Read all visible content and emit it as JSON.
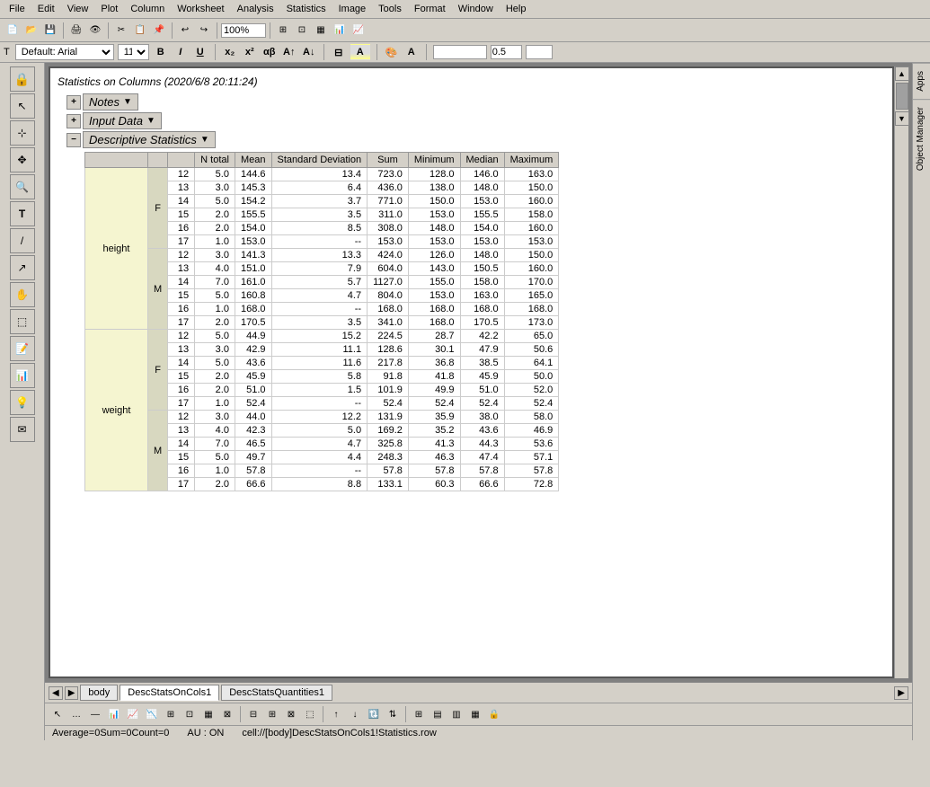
{
  "window": {
    "title": "Statistics on Columns (2020/6/8 20:11:24)"
  },
  "menu": {
    "items": [
      "File",
      "Edit",
      "View",
      "Plot",
      "Column",
      "Worksheet",
      "Analysis",
      "Statistics",
      "Image",
      "Tools",
      "Format",
      "Window",
      "Help"
    ]
  },
  "format_bar": {
    "font": "Default: Arial",
    "size": "11",
    "bold": "B",
    "italic": "I",
    "underline": "U",
    "zoom": "100%"
  },
  "tree": {
    "notes_label": "Notes",
    "input_label": "Input Data",
    "desc_label": "Descriptive Statistics"
  },
  "table": {
    "headers": [
      "",
      "",
      "",
      "N total",
      "Mean",
      "Standard Deviation",
      "Sum",
      "Minimum",
      "Median",
      "Maximum"
    ],
    "rows": [
      {
        "group1": "height",
        "group2": "F",
        "age": "12",
        "n": "5.0",
        "mean": "144.6",
        "sd": "13.4",
        "sum": "723.0",
        "min": "128.0",
        "median": "146.0",
        "max": "163.0"
      },
      {
        "group1": "",
        "group2": "",
        "age": "13",
        "n": "3.0",
        "mean": "145.3",
        "sd": "6.4",
        "sum": "436.0",
        "min": "138.0",
        "median": "148.0",
        "max": "150.0"
      },
      {
        "group1": "",
        "group2": "",
        "age": "14",
        "n": "5.0",
        "mean": "154.2",
        "sd": "3.7",
        "sum": "771.0",
        "min": "150.0",
        "median": "153.0",
        "max": "160.0"
      },
      {
        "group1": "",
        "group2": "",
        "age": "15",
        "n": "2.0",
        "mean": "155.5",
        "sd": "3.5",
        "sum": "311.0",
        "min": "153.0",
        "median": "155.5",
        "max": "158.0"
      },
      {
        "group1": "",
        "group2": "",
        "age": "16",
        "n": "2.0",
        "mean": "154.0",
        "sd": "8.5",
        "sum": "308.0",
        "min": "148.0",
        "median": "154.0",
        "max": "160.0"
      },
      {
        "group1": "",
        "group2": "",
        "age": "17",
        "n": "1.0",
        "mean": "153.0",
        "sd": "--",
        "sum": "153.0",
        "min": "153.0",
        "median": "153.0",
        "max": "153.0"
      },
      {
        "group1": "",
        "group2": "M",
        "age": "12",
        "n": "3.0",
        "mean": "141.3",
        "sd": "13.3",
        "sum": "424.0",
        "min": "126.0",
        "median": "148.0",
        "max": "150.0"
      },
      {
        "group1": "",
        "group2": "",
        "age": "13",
        "n": "4.0",
        "mean": "151.0",
        "sd": "7.9",
        "sum": "604.0",
        "min": "143.0",
        "median": "150.5",
        "max": "160.0"
      },
      {
        "group1": "",
        "group2": "",
        "age": "14",
        "n": "7.0",
        "mean": "161.0",
        "sd": "5.7",
        "sum": "1127.0",
        "min": "155.0",
        "median": "158.0",
        "max": "170.0"
      },
      {
        "group1": "",
        "group2": "",
        "age": "15",
        "n": "5.0",
        "mean": "160.8",
        "sd": "4.7",
        "sum": "804.0",
        "min": "153.0",
        "median": "163.0",
        "max": "165.0"
      },
      {
        "group1": "",
        "group2": "",
        "age": "16",
        "n": "1.0",
        "mean": "168.0",
        "sd": "--",
        "sum": "168.0",
        "min": "168.0",
        "median": "168.0",
        "max": "168.0"
      },
      {
        "group1": "",
        "group2": "",
        "age": "17",
        "n": "2.0",
        "mean": "170.5",
        "sd": "3.5",
        "sum": "341.0",
        "min": "168.0",
        "median": "170.5",
        "max": "173.0"
      },
      {
        "group1": "weight",
        "group2": "F",
        "age": "12",
        "n": "5.0",
        "mean": "44.9",
        "sd": "15.2",
        "sum": "224.5",
        "min": "28.7",
        "median": "42.2",
        "max": "65.0"
      },
      {
        "group1": "",
        "group2": "",
        "age": "13",
        "n": "3.0",
        "mean": "42.9",
        "sd": "11.1",
        "sum": "128.6",
        "min": "30.1",
        "median": "47.9",
        "max": "50.6"
      },
      {
        "group1": "",
        "group2": "",
        "age": "14",
        "n": "5.0",
        "mean": "43.6",
        "sd": "11.6",
        "sum": "217.8",
        "min": "36.8",
        "median": "38.5",
        "max": "64.1"
      },
      {
        "group1": "",
        "group2": "",
        "age": "15",
        "n": "2.0",
        "mean": "45.9",
        "sd": "5.8",
        "sum": "91.8",
        "min": "41.8",
        "median": "45.9",
        "max": "50.0"
      },
      {
        "group1": "",
        "group2": "",
        "age": "16",
        "n": "2.0",
        "mean": "51.0",
        "sd": "1.5",
        "sum": "101.9",
        "min": "49.9",
        "median": "51.0",
        "max": "52.0"
      },
      {
        "group1": "",
        "group2": "",
        "age": "17",
        "n": "1.0",
        "mean": "52.4",
        "sd": "--",
        "sum": "52.4",
        "min": "52.4",
        "median": "52.4",
        "max": "52.4"
      },
      {
        "group1": "",
        "group2": "M",
        "age": "12",
        "n": "3.0",
        "mean": "44.0",
        "sd": "12.2",
        "sum": "131.9",
        "min": "35.9",
        "median": "38.0",
        "max": "58.0"
      },
      {
        "group1": "",
        "group2": "",
        "age": "13",
        "n": "4.0",
        "mean": "42.3",
        "sd": "5.0",
        "sum": "169.2",
        "min": "35.2",
        "median": "43.6",
        "max": "46.9"
      },
      {
        "group1": "",
        "group2": "",
        "age": "14",
        "n": "7.0",
        "mean": "46.5",
        "sd": "4.7",
        "sum": "325.8",
        "min": "41.3",
        "median": "44.3",
        "max": "53.6"
      },
      {
        "group1": "",
        "group2": "",
        "age": "15",
        "n": "5.0",
        "mean": "49.7",
        "sd": "4.4",
        "sum": "248.3",
        "min": "46.3",
        "median": "47.4",
        "max": "57.1"
      },
      {
        "group1": "",
        "group2": "",
        "age": "16",
        "n": "1.0",
        "mean": "57.8",
        "sd": "--",
        "sum": "57.8",
        "min": "57.8",
        "median": "57.8",
        "max": "57.8"
      },
      {
        "group1": "",
        "group2": "",
        "age": "17",
        "n": "2.0",
        "mean": "66.6",
        "sd": "8.8",
        "sum": "133.1",
        "min": "60.3",
        "median": "66.6",
        "max": "72.8"
      }
    ]
  },
  "tabs": {
    "body": "body",
    "desc_stats": "DescStatsOnCols1",
    "desc_quantities": "DescStatsQuantities1"
  },
  "status": {
    "average": "Average=0",
    "sum": "Sum=0",
    "count": "Count=0",
    "au": "AU : ON",
    "cell": "cell://[body]DescStatsOnCols1!Statistics.row"
  }
}
